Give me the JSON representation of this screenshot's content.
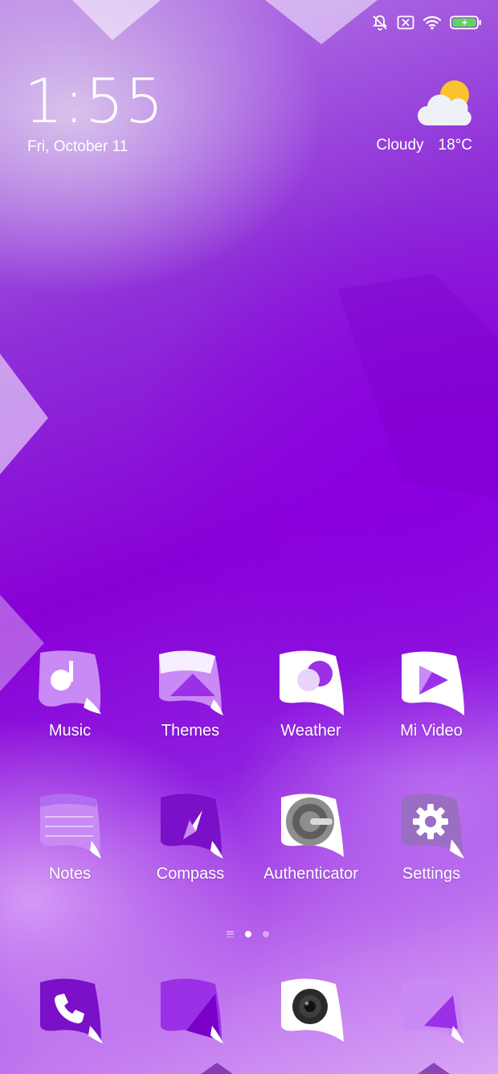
{
  "status_bar": {
    "icons": [
      "mute-bell-icon",
      "sim-error-icon",
      "wifi-icon",
      "battery-charging-icon"
    ],
    "battery_color": "#5cd65c"
  },
  "lockscreen_widget": {
    "time": "1:55",
    "date": "Fri, October 11",
    "weather_condition": "Cloudy",
    "temperature": "18°C"
  },
  "home_apps": [
    {
      "label": "Music",
      "icon": "music-icon"
    },
    {
      "label": "Themes",
      "icon": "themes-icon"
    },
    {
      "label": "Weather",
      "icon": "weather-app-icon"
    },
    {
      "label": "Mi Video",
      "icon": "play-icon"
    },
    {
      "label": "Notes",
      "icon": "notes-icon"
    },
    {
      "label": "Compass",
      "icon": "compass-icon"
    },
    {
      "label": "Authenticator",
      "icon": "authenticator-icon"
    },
    {
      "label": "Settings",
      "icon": "gear-icon"
    }
  ],
  "page_indicator": {
    "pages": 2,
    "active_page": 1
  },
  "dock": [
    {
      "icon": "phone-icon"
    },
    {
      "icon": "messaging-icon"
    },
    {
      "icon": "camera-icon"
    },
    {
      "icon": "gallery-icon"
    }
  ],
  "colors": {
    "accent": "#8800d6",
    "icon_purple": "#9b30e6",
    "icon_light": "#c98af5"
  }
}
